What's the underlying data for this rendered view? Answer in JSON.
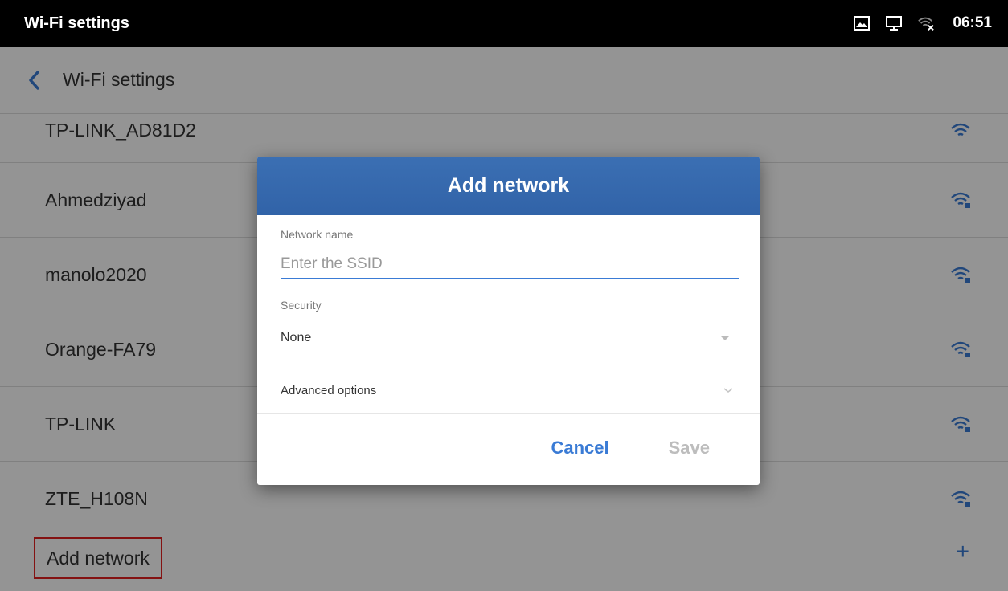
{
  "status_bar": {
    "title": "Wi-Fi settings",
    "time": "06:51",
    "icons": [
      "gallery-icon",
      "monitor-icon",
      "wifi-off-icon"
    ]
  },
  "header": {
    "back_icon": "chevron-left-icon",
    "title": "Wi-Fi settings"
  },
  "networks": [
    {
      "ssid": "TP-LINK_AD81D2",
      "icon": "wifi-icon"
    },
    {
      "ssid": "Ahmedziyad",
      "icon": "wifi-lock-icon"
    },
    {
      "ssid": "manolo2020",
      "icon": "wifi-lock-icon"
    },
    {
      "ssid": "Orange-FA79",
      "icon": "wifi-lock-icon"
    },
    {
      "ssid": "TP-LINK",
      "icon": "wifi-lock-icon"
    },
    {
      "ssid": "ZTE_H108N",
      "icon": "wifi-lock-icon"
    }
  ],
  "add_network": {
    "label": "Add network",
    "icon": "plus-icon",
    "icon_glyph": "+"
  },
  "dialog": {
    "title": "Add network",
    "network_name_label": "Network name",
    "network_name_placeholder": "Enter the SSID",
    "network_name_value": "",
    "security_label": "Security",
    "security_value": "None",
    "advanced_label": "Advanced options",
    "cancel_label": "Cancel",
    "save_label": "Save"
  },
  "colors": {
    "accent": "#3a7bd5",
    "dialog_header": "#3367ad",
    "highlight_box": "#e41f1f",
    "disabled": "#bdbdbd"
  }
}
